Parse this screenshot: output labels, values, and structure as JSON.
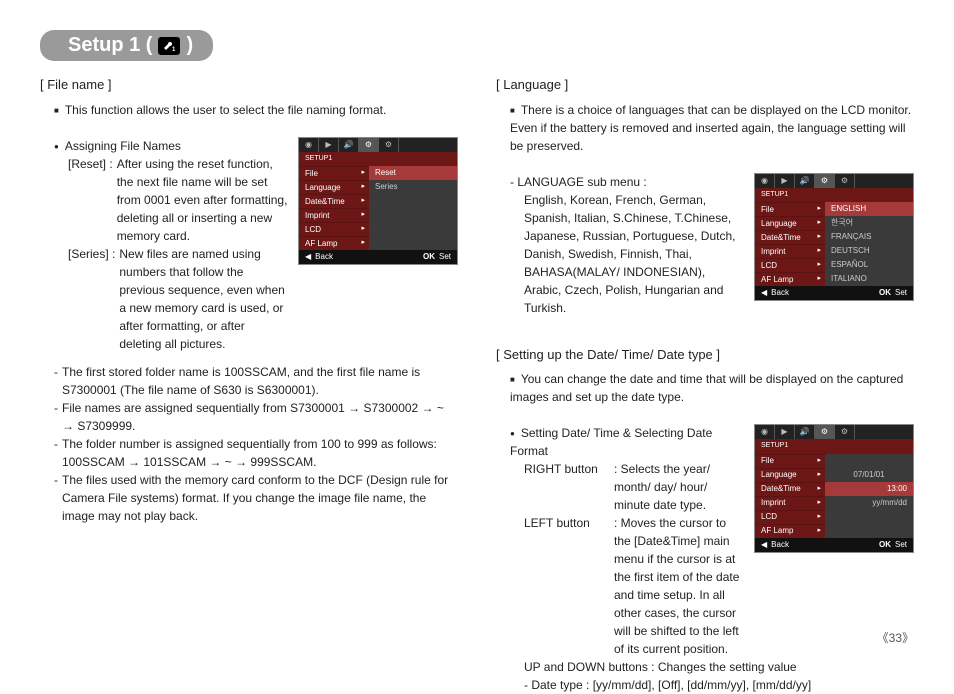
{
  "title": {
    "prefix": "Setup 1 (",
    "suffix": ")"
  },
  "page_number": "《33》",
  "left": {
    "file_name": {
      "heading": "[ File name ]",
      "intro": "This function allows the user to select the file naming format.",
      "assign_label": "Assigning File Names",
      "reset_label": "[Reset] :",
      "reset_text": "After using the reset function, the next file name will be set from 0001 even after formatting, deleting all or inserting a new memory card.",
      "series_label": "[Series] :",
      "series_text": "New files are named using numbers that follow the previous sequence, even when a new memory card is used, or after formatting, or after deleting all pictures.",
      "note1": "The first stored folder name is 100SSCAM, and the first file name is S7300001 (The file name of S630 is S6300001).",
      "note2": "File names are assigned sequentially from S7300001 → S7300002 → ~ → S7309999.",
      "note3": "The folder number is assigned sequentially from 100 to 999 as follows: 100SSCAM → 101SSCAM → ~ → 999SSCAM.",
      "note4": "The files used with the memory card conform to the DCF (Design rule for Camera File systems) format. If you change the image file name, the image may not play back."
    },
    "lcd": {
      "header": "SETUP1",
      "rows": [
        {
          "label": "File",
          "value": "Reset",
          "highlight": true
        },
        {
          "label": "Language",
          "value": "Series"
        },
        {
          "label": "Date&Time",
          "value": ""
        },
        {
          "label": "Imprint",
          "value": ""
        },
        {
          "label": "LCD",
          "value": ""
        },
        {
          "label": "AF Lamp",
          "value": ""
        }
      ],
      "footer_back": "Back",
      "footer_ok": "OK",
      "footer_set": "Set"
    }
  },
  "right": {
    "language": {
      "heading": "[ Language ]",
      "intro": "There is a choice of languages that can be displayed on the LCD monitor. Even if the battery is removed and inserted again, the language setting will be preserved.",
      "sub_label": "- LANGUAGE sub menu :",
      "sub_text": "English, Korean, French, German, Spanish, Italian, S.Chinese, T.Chinese, Japanese, Russian, Portuguese, Dutch, Danish, Swedish, Finnish, Thai, BAHASA(MALAY/ INDONESIAN), Arabic, Czech, Polish, Hungarian and Turkish."
    },
    "lcd_lang": {
      "header": "SETUP1",
      "rows": [
        {
          "label": "File",
          "value": "ENGLISH",
          "highlight": true
        },
        {
          "label": "Language",
          "value": "한국어"
        },
        {
          "label": "Date&Time",
          "value": "FRANÇAIS"
        },
        {
          "label": "Imprint",
          "value": "DEUTSCH"
        },
        {
          "label": "LCD",
          "value": "ESPAÑOL"
        },
        {
          "label": "AF Lamp",
          "value": "ITALIANO"
        }
      ],
      "footer_back": "Back",
      "footer_ok": "OK",
      "footer_set": "Set"
    },
    "datetime": {
      "heading": "[ Setting up the Date/ Time/ Date type ]",
      "intro": "You can change the date and time that will be displayed on the captured images and set up the date type.",
      "setting_label": "Setting Date/ Time & Selecting Date Format",
      "right_btn_label": "RIGHT button",
      "right_btn_text": ": Selects the year/ month/ day/ hour/ minute date type.",
      "left_btn_label": "LEFT button",
      "left_btn_text": ": Moves the cursor to the [Date&Time] main menu if the cursor is at the first item of the date and time setup. In all other cases, the cursor will be shifted to the left of its current position.",
      "updown_text": "UP and DOWN buttons : Changes the setting value",
      "datetype_text": "- Date type : [yy/mm/dd], [Off], [dd/mm/yy], [mm/dd/yy]"
    },
    "lcd_date": {
      "header": "SETUP1",
      "rows": [
        {
          "label": "File",
          "value": ""
        },
        {
          "label": "Language",
          "value": "07/01/01",
          "tri": "up"
        },
        {
          "label": "Date&Time",
          "value": "13:00",
          "highlight": true
        },
        {
          "label": "Imprint",
          "value": "yy/mm/dd",
          "tri": "down"
        },
        {
          "label": "LCD",
          "value": ""
        },
        {
          "label": "AF Lamp",
          "value": ""
        }
      ],
      "footer_back": "Back",
      "footer_ok": "OK",
      "footer_set": "Set"
    }
  }
}
